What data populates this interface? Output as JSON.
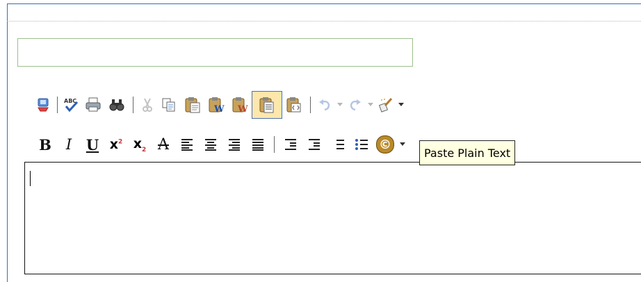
{
  "title_field": {
    "value": "",
    "placeholder": ""
  },
  "toolbar_row1": [
    {
      "name": "save-icon",
      "label": "Save"
    },
    {
      "name": "spellcheck-icon",
      "label": "ABC"
    },
    {
      "name": "print-icon",
      "label": "Print"
    },
    {
      "name": "find-icon",
      "label": "Find"
    },
    {
      "name": "cut-icon",
      "label": "Cut"
    },
    {
      "name": "copy-icon",
      "label": "Copy"
    },
    {
      "name": "paste-icon",
      "label": "Paste"
    },
    {
      "name": "paste-word-icon",
      "label": "Paste from Word"
    },
    {
      "name": "paste-word-alt-icon",
      "label": "Paste from Word"
    },
    {
      "name": "paste-plain-text-icon",
      "label": "Paste Plain Text",
      "state": "hover"
    },
    {
      "name": "paste-html-icon",
      "label": "Paste HTML"
    },
    {
      "name": "undo-icon",
      "label": "Undo"
    },
    {
      "name": "redo-icon",
      "label": "Redo"
    },
    {
      "name": "format-stripper-icon",
      "label": "Format Stripper"
    }
  ],
  "toolbar_row2": {
    "bold": "B",
    "italic": "I",
    "underline": "U",
    "superscript": "x",
    "superscript_mark": "2",
    "subscript": "x",
    "subscript_mark": "2",
    "strikethrough": "A",
    "insert_symbol": "©"
  },
  "tooltip": {
    "text": "Paste Plain Text"
  },
  "editor": {
    "content": ""
  },
  "colors": {
    "frame_border": "#3d6ba8",
    "input_border": "#9cc08a",
    "active_bg": "#fde7ad",
    "tooltip_bg": "#ffffe1"
  }
}
